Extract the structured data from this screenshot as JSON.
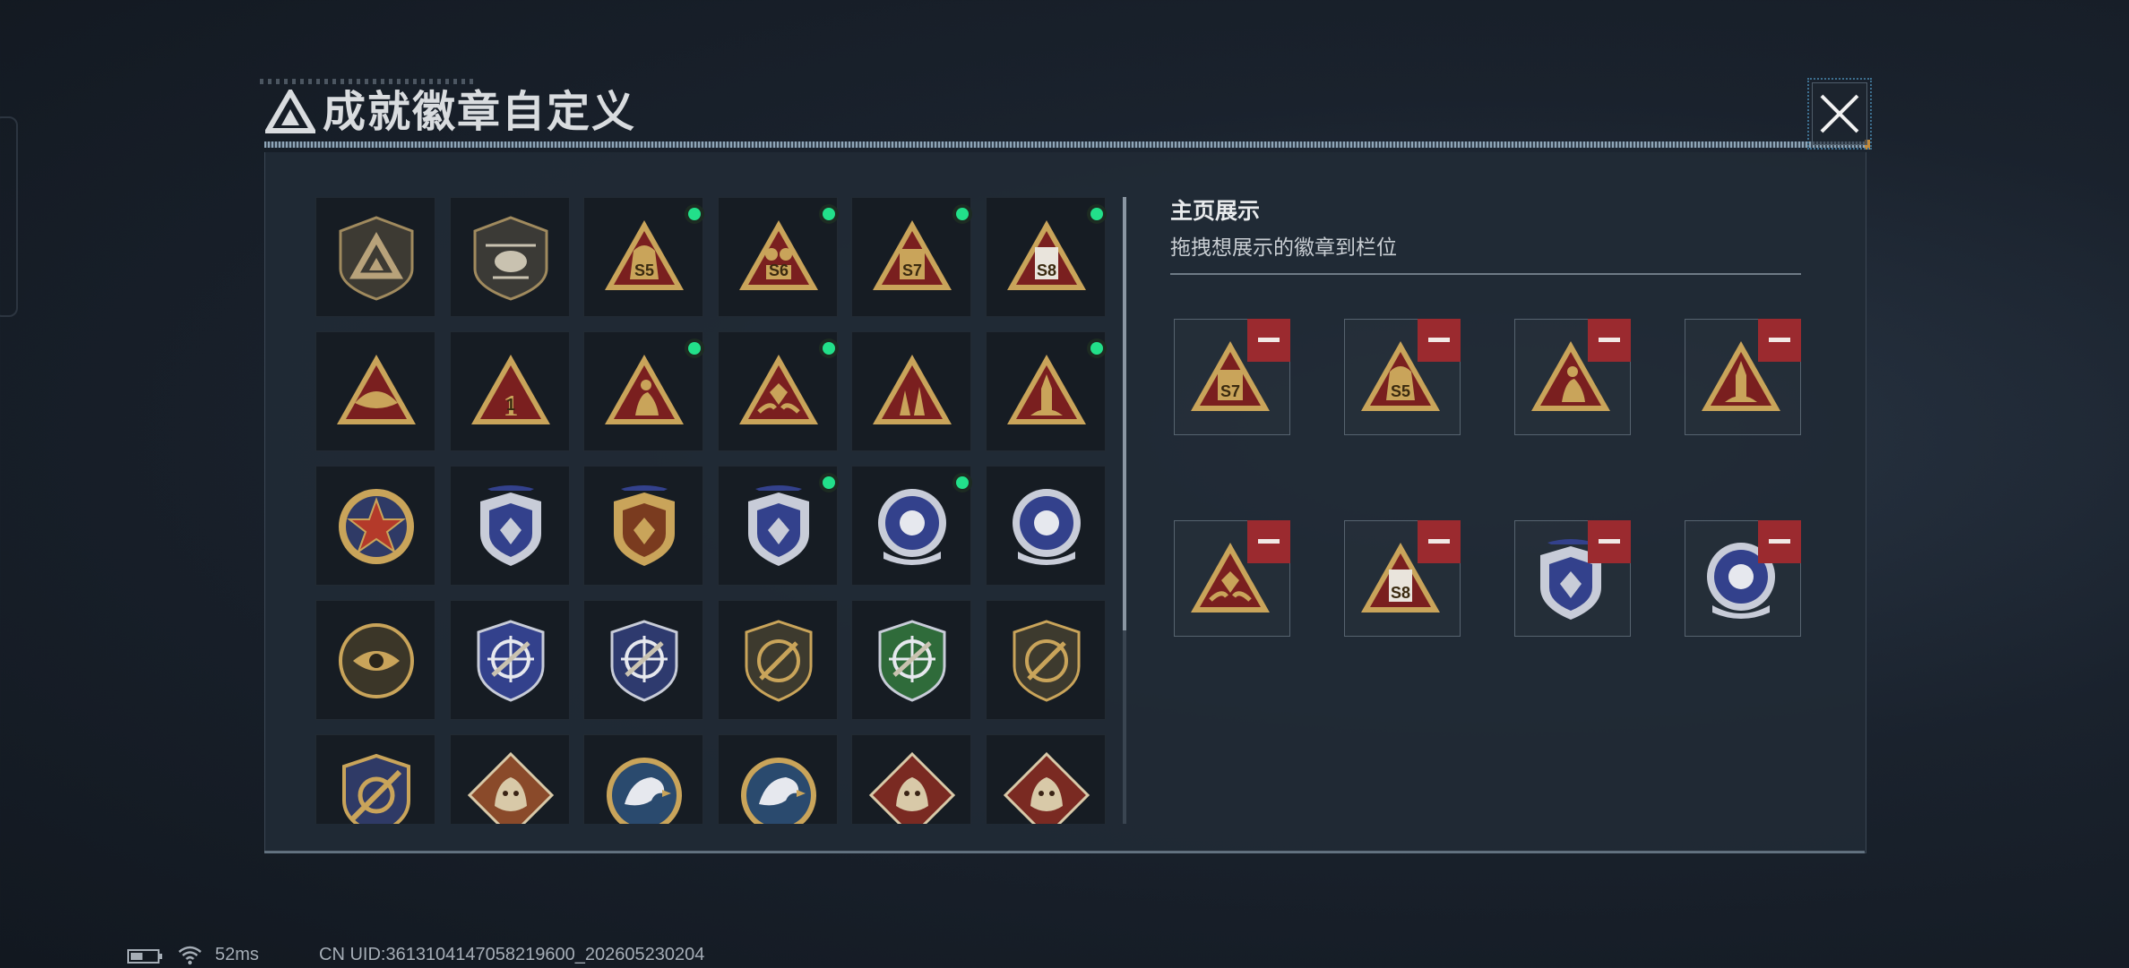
{
  "header": {
    "title": "成就徽章自定义",
    "close_icon": "close-x-icon"
  },
  "badge_grid": {
    "rows": [
      [
        {
          "icon": "triangle-logo-shield-badge",
          "selected": false
        },
        {
          "icon": "helicopter-shield-badge",
          "selected": false
        },
        {
          "icon": "triangle-bag-s5-badge",
          "label": "S5",
          "selected": true
        },
        {
          "icon": "triangle-s6-badge",
          "label": "S6",
          "selected": true
        },
        {
          "icon": "triangle-s7-badge",
          "label": "S7",
          "selected": true
        },
        {
          "icon": "triangle-s8-badge",
          "label": "S8",
          "selected": true
        }
      ],
      [
        {
          "icon": "triangle-bird-badge",
          "selected": false
        },
        {
          "icon": "triangle-number-one-badge",
          "label": "1",
          "selected": false
        },
        {
          "icon": "triangle-figure-badge",
          "selected": true
        },
        {
          "icon": "triangle-gem-hands-badge",
          "selected": true
        },
        {
          "icon": "triangle-soldiers-badge",
          "selected": false
        },
        {
          "icon": "triangle-rocket-badge",
          "selected": true
        }
      ],
      [
        {
          "icon": "star-medal-badge",
          "selected": false
        },
        {
          "icon": "blue-shield-emblem-badge",
          "selected": false
        },
        {
          "icon": "gold-shield-emblem-badge",
          "selected": false
        },
        {
          "icon": "blue-shield-gem-badge",
          "selected": true
        },
        {
          "icon": "blue-globe-badge",
          "selected": true
        },
        {
          "icon": "blue-round-figure-badge",
          "selected": false
        }
      ],
      [
        {
          "icon": "eye-medallion-badge",
          "selected": false
        },
        {
          "icon": "crosshair-rifle-blue-badge",
          "selected": false
        },
        {
          "icon": "crosshair-rifle-dark-badge",
          "selected": false
        },
        {
          "icon": "bow-shield-badge",
          "selected": false
        },
        {
          "icon": "crosshair-rifle-green-badge",
          "selected": false
        },
        {
          "icon": "bow-shield-dark-badge",
          "selected": false
        }
      ],
      [
        {
          "icon": "crossed-target-shield-badge",
          "selected": false
        },
        {
          "icon": "wolf-diamond-badge",
          "selected": false
        },
        {
          "icon": "eagle-medallion-badge",
          "selected": false
        },
        {
          "icon": "eagle-medallion-badge",
          "selected": false
        },
        {
          "icon": "dragon-diamond-badge",
          "selected": false
        },
        {
          "icon": "dragon-diamond-badge",
          "selected": false
        }
      ]
    ]
  },
  "showcase": {
    "title": "主页展示",
    "subtitle": "拖拽想展示的徽章到栏位",
    "remove_icon": "minus-icon",
    "slots": [
      {
        "icon": "triangle-s7-badge",
        "label": "S7"
      },
      {
        "icon": "triangle-bag-s5-badge",
        "label": "S5"
      },
      {
        "icon": "triangle-figure-badge"
      },
      {
        "icon": "triangle-rocket-badge"
      },
      {
        "icon": "triangle-gem-hands-badge"
      },
      {
        "icon": "triangle-s8-badge",
        "label": "S8"
      },
      {
        "icon": "blue-shield-gem-badge"
      },
      {
        "icon": "blue-globe-badge"
      }
    ]
  },
  "status_bar": {
    "battery_icon": "battery-icon",
    "wifi_icon": "wifi-icon",
    "ping": "52ms",
    "uid": "CN UID:3613104147058219600_202605230204"
  },
  "colors": {
    "selected_dot": "#22e08a",
    "remove_button": "#9b2a2f",
    "badge_gold": "#c9a45a",
    "badge_red": "#7a1f1f",
    "badge_blue": "#33418c",
    "badge_green": "#2f6b3a"
  }
}
